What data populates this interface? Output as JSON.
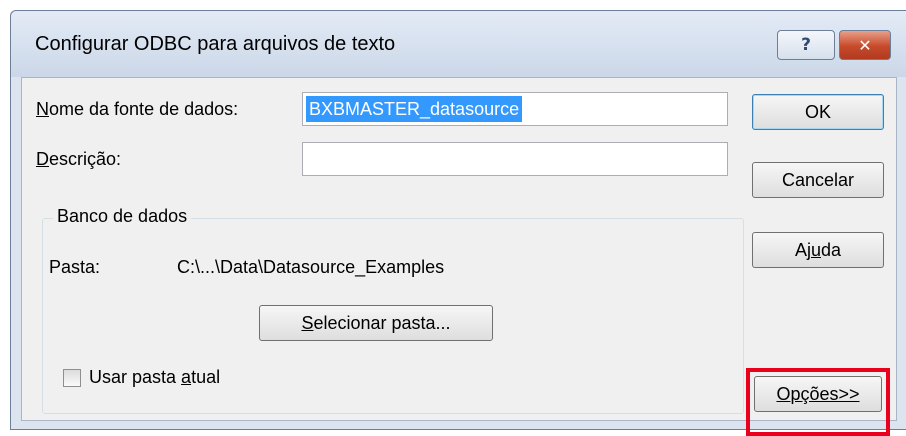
{
  "window": {
    "title": "Configurar ODBC para arquivos de texto",
    "help_label": "?",
    "close_label": "✕"
  },
  "form": {
    "name_label_mnemonic": "N",
    "name_label_rest": "ome da fonte de dados:",
    "name_value": "BXBMASTER_datasource",
    "desc_label_mnemonic": "D",
    "desc_label_rest": "escrição:",
    "desc_value": ""
  },
  "database": {
    "group_title": "Banco de dados",
    "folder_label": "Pasta:",
    "folder_value": "C:\\...\\Data\\Datasource_Examples",
    "select_folder_mnemonic": "S",
    "select_folder_rest": "elecionar pasta...",
    "use_current_prefix": "Usar pasta ",
    "use_current_mnemonic": "a",
    "use_current_rest": "tual",
    "use_current_checked": false
  },
  "buttons": {
    "ok": "OK",
    "cancel": "Cancelar",
    "help_prefix": "Aj",
    "help_mnemonic": "u",
    "help_rest": "da",
    "options_prefix": "O",
    "options_mnemonic": "p",
    "options_rest": "ções>>"
  },
  "colors": {
    "selection": "#3399ff",
    "highlight_box": "#e8001c"
  }
}
